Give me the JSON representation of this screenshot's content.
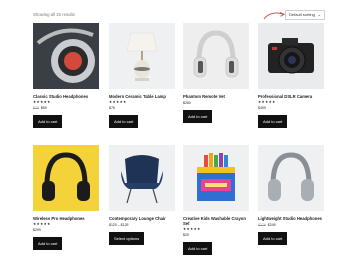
{
  "shop": {
    "result_count": "Showing all 15 results",
    "sort": {
      "selected": "Default sorting"
    }
  },
  "products": [
    {
      "name": "Classic Studio Headphones",
      "rating": "★★★★★",
      "old_price": "$79",
      "price": "$59",
      "button": "Add to cart",
      "image_icon": "headphones-closeup-icon"
    },
    {
      "name": "Modern Ceramic Table Lamp",
      "rating": "★★★★★",
      "old_price": "",
      "price": "$75",
      "button": "Add to cart",
      "image_icon": "table-lamp-icon"
    },
    {
      "name": "Phantom Remote Vet",
      "rating": "",
      "old_price": "",
      "price": "$260",
      "button": "Add to cart",
      "image_icon": "headphones-white-icon"
    },
    {
      "name": "Professional DSLR Camera",
      "rating": "★★★★★",
      "old_price": "",
      "price": "$499",
      "button": "Add to cart",
      "image_icon": "camera-icon"
    },
    {
      "name": "Wireless Pro Headphones",
      "rating": "★★★★★",
      "old_price": "",
      "price": "$299",
      "button": "Add to cart",
      "image_icon": "headphones-yellow-icon"
    },
    {
      "name": "Contemporary Lounge Chair",
      "rating": "",
      "old_price": "",
      "price": "$120 – $125",
      "button": "Select options",
      "image_icon": "lounge-chair-icon"
    },
    {
      "name": "Creative Kids Washable Crayon Set",
      "rating": "★★★★★",
      "old_price": "",
      "price": "$20",
      "button": "Add to cart",
      "image_icon": "crayon-box-icon"
    },
    {
      "name": "Lightweight Studio Headphones",
      "rating": "",
      "old_price": "$279",
      "price": "$249",
      "button": "Add to cart",
      "image_icon": "headphones-grey-icon"
    }
  ],
  "colors": {
    "accent_arrow": "#d9534f",
    "button_bg": "#111111"
  }
}
